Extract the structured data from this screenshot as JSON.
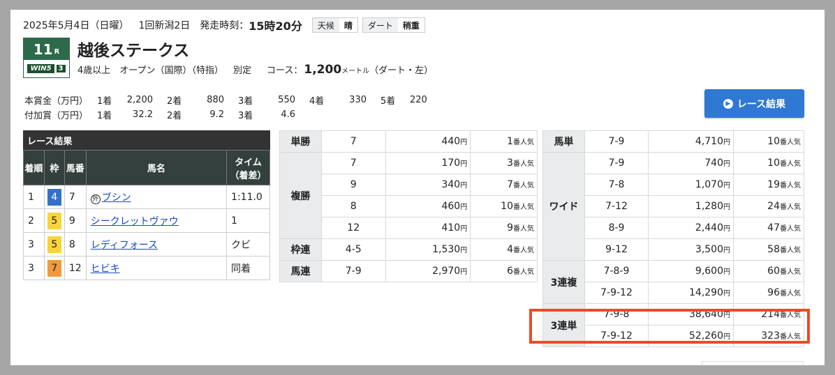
{
  "header": {
    "date": "2025年5月4日（日曜）",
    "meeting": "1回新潟2日",
    "start_label": "発走時刻：",
    "start_time": "15時20分",
    "weather_label": "天候",
    "weather_value": "晴",
    "track_label": "ダート",
    "track_value": "稍重"
  },
  "race": {
    "number": "11",
    "number_suffix": "R",
    "win5_label": "WIN5",
    "win5_num": "3",
    "title": "越後ステークス",
    "conditions": "4歳以上　オープン（国際）（特指）",
    "weight": "別定",
    "course_label": "コース：",
    "distance": "1,200",
    "distance_unit": "メートル",
    "course_detail": "（ダート・左）"
  },
  "prize": {
    "rows": [
      {
        "label": "本賞金（万円）",
        "cells": [
          "1着",
          "2,200",
          "2着",
          "880",
          "3着",
          "550",
          "4着",
          "330",
          "5着",
          "220"
        ]
      },
      {
        "label": "付加賞（万円）",
        "cells": [
          "1着",
          "32.2",
          "2着",
          "9.2",
          "3着",
          "4.6",
          "",
          "",
          "",
          ""
        ]
      }
    ]
  },
  "result_button": {
    "label": "レース結果"
  },
  "results": {
    "caption": "レース結果",
    "headers": [
      "着順",
      "枠",
      "馬番",
      "馬名",
      "タイム（着差）"
    ],
    "rows": [
      {
        "pos": "1",
        "waku": "4",
        "num": "7",
        "foreign": "外",
        "name": "ブシン",
        "time": "1:11.0"
      },
      {
        "pos": "2",
        "waku": "5",
        "num": "9",
        "foreign": "",
        "name": "シークレットヴァウ",
        "time": "1"
      },
      {
        "pos": "3",
        "waku": "5",
        "num": "8",
        "foreign": "",
        "name": "レディフォース",
        "time": "クビ"
      },
      {
        "pos": "3",
        "waku": "7",
        "num": "12",
        "foreign": "",
        "name": "ヒビキ",
        "time": "同着"
      }
    ]
  },
  "odds_left": {
    "tansho": {
      "kind": "単勝",
      "rows": [
        {
          "combo": "7",
          "pay": "440",
          "pop": "1"
        }
      ]
    },
    "fukusho": {
      "kind": "複勝",
      "rows": [
        {
          "combo": "7",
          "pay": "170",
          "pop": "3"
        },
        {
          "combo": "9",
          "pay": "340",
          "pop": "7"
        },
        {
          "combo": "8",
          "pay": "460",
          "pop": "10"
        },
        {
          "combo": "12",
          "pay": "410",
          "pop": "9"
        }
      ]
    },
    "wakuren": {
      "kind": "枠連",
      "rows": [
        {
          "combo": "4-5",
          "pay": "1,530",
          "pop": "4"
        }
      ]
    },
    "umaren": {
      "kind": "馬連",
      "rows": [
        {
          "combo": "7-9",
          "pay": "2,970",
          "pop": "6"
        }
      ]
    }
  },
  "odds_right": {
    "umatan": {
      "kind": "馬単",
      "rows": [
        {
          "combo": "7-9",
          "pay": "4,710",
          "pop": "10"
        }
      ]
    },
    "wide": {
      "kind": "ワイド",
      "rows": [
        {
          "combo": "7-9",
          "pay": "740",
          "pop": "10"
        },
        {
          "combo": "7-8",
          "pay": "1,070",
          "pop": "19"
        },
        {
          "combo": "7-12",
          "pay": "1,280",
          "pop": "24"
        },
        {
          "combo": "8-9",
          "pay": "2,440",
          "pop": "47"
        },
        {
          "combo": "9-12",
          "pay": "3,500",
          "pop": "58"
        }
      ]
    },
    "sanrenpuku": {
      "kind": "3連複",
      "rows": [
        {
          "combo": "7-8-9",
          "pay": "9,600",
          "pop": "60"
        },
        {
          "combo": "7-9-12",
          "pay": "14,290",
          "pop": "96"
        }
      ]
    },
    "sanrentan": {
      "kind": "3連単",
      "rows": [
        {
          "combo": "7-9-8",
          "pay": "38,640",
          "pop": "214"
        },
        {
          "combo": "7-9-12",
          "pay": "52,260",
          "pop": "323"
        }
      ]
    }
  },
  "units": {
    "yen": "円",
    "popularity": "番人気"
  },
  "colors": {
    "highlight_box": "#e84d26",
    "button": "#2f78d3",
    "race_badge": "#2b6a4b"
  }
}
